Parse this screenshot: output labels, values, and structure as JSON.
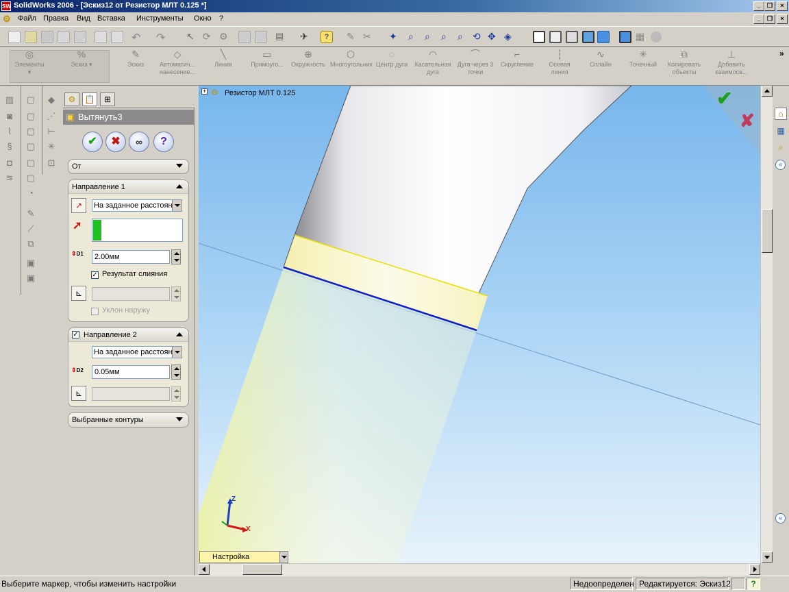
{
  "window": {
    "title": "SolidWorks 2006 - [Эскиз12 от Резистор МЛТ 0.125 *]",
    "app_icon": "SW"
  },
  "menu": [
    "Файл",
    "Правка",
    "Вид",
    "Вставка",
    "Инструменты",
    "Окно",
    "?"
  ],
  "command_manager": {
    "items": [
      {
        "label": "Элементы"
      },
      {
        "label": "Эскиз"
      },
      {
        "label": "Эскиз"
      },
      {
        "label": "Автоматич... нанесение..."
      },
      {
        "label": "Линия"
      },
      {
        "label": "Прямоуго..."
      },
      {
        "label": "Окружность"
      },
      {
        "label": "Многоугольник"
      },
      {
        "label": "Центр дуги"
      },
      {
        "label": "Касательная дуга"
      },
      {
        "label": "Дуга через 3 точки"
      },
      {
        "label": "Скругление"
      },
      {
        "label": "Осевая линия"
      },
      {
        "label": "Сплайн"
      },
      {
        "label": "Точечный"
      },
      {
        "label": "Копировать объекты"
      },
      {
        "label": "Добавить взаимосв..."
      }
    ],
    "more": "»"
  },
  "property_manager": {
    "feature_title": "Вытянуть3",
    "from": {
      "label": "От"
    },
    "direction1": {
      "title": "Направление 1",
      "end_condition": "На заданное расстоян",
      "depth": "2.00мм",
      "depth_tag": "D1",
      "merge_result": "Результат слияния",
      "draft_outward": "Уклон наружу"
    },
    "direction2": {
      "title": "Направление 2",
      "end_condition": "На заданное расстоян",
      "depth": "0.05мм",
      "depth_tag": "D2"
    },
    "selected_contours": {
      "title": "Выбранные контуры"
    }
  },
  "viewport": {
    "tree_root": "Резистор МЛТ 0.125",
    "tree_expand": "+",
    "dropdown": "Настройка",
    "triad": {
      "x": "X",
      "z": "Z"
    }
  },
  "statusbar": {
    "message": "Выберите маркер, чтобы изменить настройки",
    "state": "Недоопределен",
    "editing": "Редактируется: Эскиз12",
    "help": "?"
  }
}
